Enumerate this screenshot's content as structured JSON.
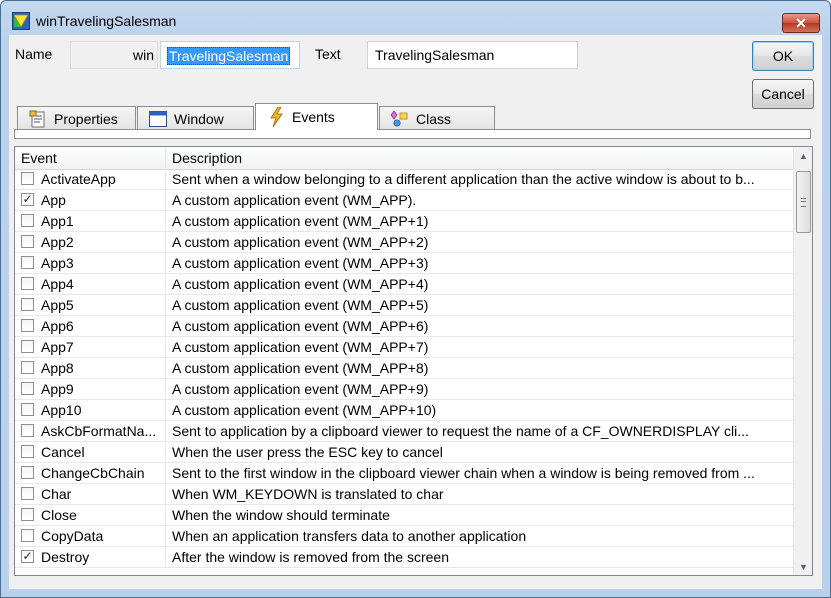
{
  "window": {
    "title": "winTravelingSalesman",
    "close_glyph": "✕"
  },
  "form": {
    "name_label": "Name",
    "prefix": "win",
    "name_value": "TravelingSalesman",
    "text_label": "Text",
    "text_value": "TravelingSalesman",
    "ok_label": "OK",
    "cancel_label": "Cancel"
  },
  "tabs": [
    {
      "label": "Properties",
      "icon": "properties-icon"
    },
    {
      "label": "Window",
      "icon": "window-icon"
    },
    {
      "label": "Events",
      "icon": "lightning-icon",
      "active": true
    },
    {
      "label": "Class",
      "icon": "class-icon"
    }
  ],
  "grid": {
    "columns": [
      "Event",
      "Description"
    ],
    "rows": [
      {
        "event": "ActivateApp",
        "checked": false,
        "description": "Sent when a window belonging to a different application than the active window is about to b..."
      },
      {
        "event": "App",
        "checked": true,
        "description": "A custom application event (WM_APP)."
      },
      {
        "event": "App1",
        "checked": false,
        "description": "A custom application event (WM_APP+1)"
      },
      {
        "event": "App2",
        "checked": false,
        "description": "A custom application event (WM_APP+2)"
      },
      {
        "event": "App3",
        "checked": false,
        "description": "A custom application event (WM_APP+3)"
      },
      {
        "event": "App4",
        "checked": false,
        "description": "A custom application event (WM_APP+4)"
      },
      {
        "event": "App5",
        "checked": false,
        "description": "A custom application event (WM_APP+5)"
      },
      {
        "event": "App6",
        "checked": false,
        "description": "A custom application event (WM_APP+6)"
      },
      {
        "event": "App7",
        "checked": false,
        "description": "A custom application event (WM_APP+7)"
      },
      {
        "event": "App8",
        "checked": false,
        "description": "A custom application event (WM_APP+8)"
      },
      {
        "event": "App9",
        "checked": false,
        "description": "A custom application event (WM_APP+9)"
      },
      {
        "event": "App10",
        "checked": false,
        "description": "A custom application event (WM_APP+10)"
      },
      {
        "event": "AskCbFormatNa...",
        "checked": false,
        "description": "Sent to application by a clipboard viewer to request the name of a CF_OWNERDISPLAY cli..."
      },
      {
        "event": "Cancel",
        "checked": false,
        "description": "When the user press the ESC key to cancel"
      },
      {
        "event": "ChangeCbChain",
        "checked": false,
        "description": "Sent to the first window in the clipboard viewer chain when a window is being removed from ..."
      },
      {
        "event": "Char",
        "checked": false,
        "description": "When WM_KEYDOWN is translated to char"
      },
      {
        "event": "Close",
        "checked": false,
        "description": "When the window should terminate"
      },
      {
        "event": "CopyData",
        "checked": false,
        "description": "When an application transfers data to another application"
      },
      {
        "event": "Destroy",
        "checked": true,
        "description": "After the window is removed from the screen"
      }
    ]
  },
  "scrollbar": {
    "up_glyph": "▲",
    "down_glyph": "▼"
  }
}
